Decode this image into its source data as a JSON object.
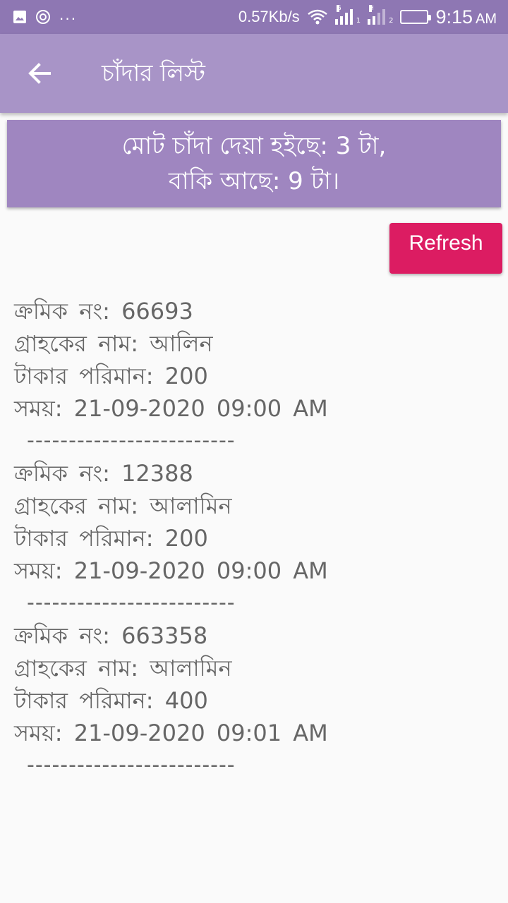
{
  "status_bar": {
    "net_speed": "0.57Kb/s",
    "time": "9:15",
    "ampm": "AM",
    "signal1_tag": "G",
    "signal1_sub": "1",
    "signal2_tag": "H",
    "signal2_sub": "2",
    "dots": "..."
  },
  "app_bar": {
    "title": "চাঁদার লিস্ট",
    "back_icon": "back-arrow-icon"
  },
  "summary": {
    "line1": "মোট চাঁদা দেয়া হইছে: 3 টা,",
    "line2": "বাকি আছে: 9 টা।"
  },
  "refresh_button": {
    "label": "Refresh",
    "color": "#dc1c62"
  },
  "records": [
    {
      "serial": "ক্রমিক নং: 66693",
      "name": "গ্রাহকের নাম: আলিন",
      "amount": "টাকার পরিমান: 200",
      "time": "সময়: 21-09-2020 09:00 AM",
      "separator": "-------------------------"
    },
    {
      "serial": "ক্রমিক নং: 12388",
      "name": "গ্রাহকের নাম: আলামিন",
      "amount": "টাকার পরিমান: 200",
      "time": "সময়: 21-09-2020 09:00 AM",
      "separator": "-------------------------"
    },
    {
      "serial": "ক্রমিক নং: 663358",
      "name": "গ্রাহকের নাম: আলামিন",
      "amount": "টাকার পরিমান: 400",
      "time": "সময়: 21-09-2020 09:01 AM",
      "separator": "-------------------------"
    }
  ],
  "colors": {
    "status_bar": "#8e77b3",
    "app_bar": "#a894c7",
    "summary_bg": "#9f86c0",
    "background": "#fafafa",
    "text": "#666666"
  }
}
